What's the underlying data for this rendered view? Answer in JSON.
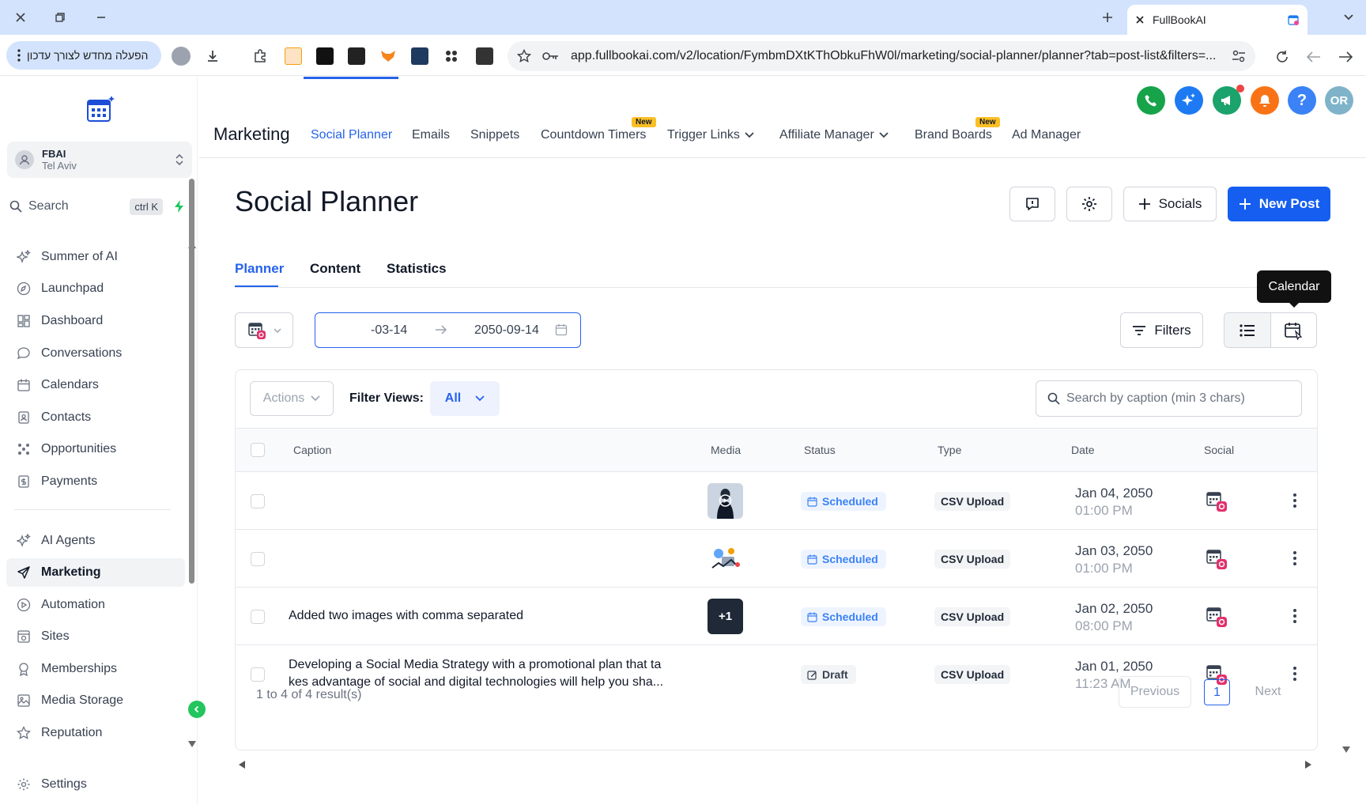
{
  "browser": {
    "tab_title": "FullBookAI",
    "reload_label": "הפעלה מחדש לצורך עדכון",
    "url": "app.fullbookai.com/v2/location/FymbmDXtKThObkuFhW0l/marketing/social-planner/planner?tab=post-list&filters=..."
  },
  "sidebar": {
    "location": {
      "name": "FBAI",
      "city": "Tel Aviv"
    },
    "search_label": "Search",
    "search_shortcut": "ctrl K",
    "items": [
      {
        "label": "Summer of AI",
        "icon": "sparkle-icon"
      },
      {
        "label": "Launchpad",
        "icon": "rocket-icon"
      },
      {
        "label": "Dashboard",
        "icon": "grid-icon"
      },
      {
        "label": "Conversations",
        "icon": "chat-bubble-icon"
      },
      {
        "label": "Calendars",
        "icon": "calendar-icon"
      },
      {
        "label": "Contacts",
        "icon": "contacts-icon"
      },
      {
        "label": "Opportunities",
        "icon": "opportunities-icon"
      },
      {
        "label": "Payments",
        "icon": "payments-icon"
      },
      {
        "label": "AI Agents",
        "icon": "sparkle-icon"
      },
      {
        "label": "Marketing",
        "icon": "send-icon",
        "active": true
      },
      {
        "label": "Automation",
        "icon": "automation-icon"
      },
      {
        "label": "Sites",
        "icon": "globe-icon"
      },
      {
        "label": "Memberships",
        "icon": "membership-icon"
      },
      {
        "label": "Media Storage",
        "icon": "image-icon"
      },
      {
        "label": "Reputation",
        "icon": "star-icon"
      }
    ],
    "settings_label": "Settings"
  },
  "header": {
    "module_title": "Marketing",
    "nav": [
      {
        "label": "Social Planner",
        "active": true
      },
      {
        "label": "Emails"
      },
      {
        "label": "Snippets"
      },
      {
        "label": "Countdown Timers",
        "badge": "New"
      },
      {
        "label": "Trigger Links",
        "dropdown": true
      },
      {
        "label": "Affiliate Manager",
        "dropdown": true
      },
      {
        "label": "Brand Boards",
        "badge": "New"
      },
      {
        "label": "Ad Manager"
      }
    ],
    "avatar_initials": "OR",
    "colors": {
      "phone": "#16a34a",
      "ai": "#1d7af2",
      "megaphone": "#1aa36b",
      "bell": "#f97316",
      "help": "#3b82f6",
      "avatar": "#7fb3c9"
    }
  },
  "page": {
    "title": "Social Planner",
    "socials_label": "Socials",
    "new_post_label": "New Post",
    "subtabs": [
      "Planner",
      "Content",
      "Statistics"
    ],
    "tooltip": "Calendar",
    "date_from": "-03-14",
    "date_to": "2050-09-14",
    "filters_label": "Filters"
  },
  "table": {
    "actions_label": "Actions",
    "filter_views_label": "Filter Views:",
    "filter_view_value": "All",
    "search_placeholder": "Search by caption (min 3 chars)",
    "columns": [
      "Caption",
      "Media",
      "Status",
      "Type",
      "Date",
      "Social"
    ],
    "rows": [
      {
        "caption_1": "",
        "caption_2": "",
        "media": "video-thumb",
        "status": "Scheduled",
        "type": "CSV Upload",
        "date": "Jan 04, 2050",
        "time": "01:00 PM"
      },
      {
        "caption_1": "",
        "caption_2": "",
        "media": "illustration-thumb",
        "status": "Scheduled",
        "type": "CSV Upload",
        "date": "Jan 03, 2050",
        "time": "01:00 PM"
      },
      {
        "caption_1": "Added two images with comma separated",
        "caption_2": "",
        "media": "multi-thumb",
        "media_count": "+1",
        "status": "Scheduled",
        "type": "CSV Upload",
        "date": "Jan 02, 2050",
        "time": "08:00 PM"
      },
      {
        "caption_1": "Developing a Social Media Strategy with a promotional plan that ta",
        "caption_2": "kes advantage of social and digital technologies will help you sha...",
        "media": "",
        "status": "Draft",
        "type": "CSV Upload",
        "date": "Jan 01, 2050",
        "time": "11:23 AM"
      }
    ],
    "results_text": "1 to 4 of 4 result(s)",
    "previous_label": "Previous",
    "page_number": "1",
    "next_label": "Next"
  }
}
